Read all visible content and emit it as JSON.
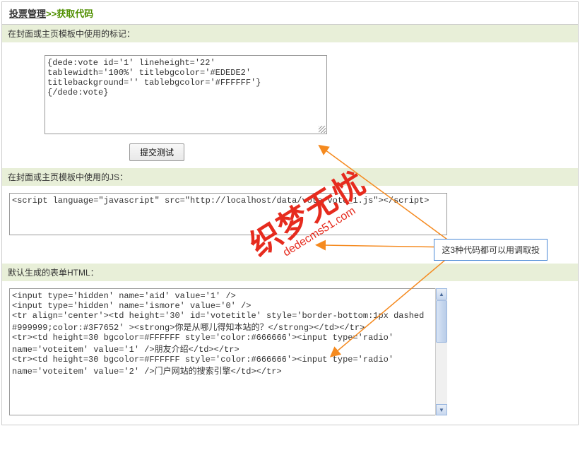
{
  "breadcrumb": {
    "vote_mgmt": "投票管理",
    "sep": ">>",
    "current": "获取代码"
  },
  "sections": {
    "tag": {
      "title": "在封面或主页模板中使用的标记：",
      "content": "{dede:vote id='1' lineheight='22'\ntablewidth='100%' titlebgcolor='#EDEDE2'\ntitlebackground='' tablebgcolor='#FFFFFF'}\n{/dede:vote}"
    },
    "js": {
      "title": "在封面或主页模板中使用的JS：",
      "content": "<script language=\"javascript\" src=\"http://localhost/data/vote/vote_1.js\"></script>"
    },
    "html": {
      "title": "默认生成的表单HTML：",
      "content": "<input type='hidden' name='aid' value='1' />\n<input type='hidden' name='ismore' value='0' />\n<tr align='center'><td height='30' id='votetitle' style='border-bottom:1px dashed #999999;color:#3F7652' ><strong>你是从哪儿得知本站的？</strong></td></tr>\n<tr><td height=30 bgcolor=#FFFFFF style='color:#666666'><input type='radio' name='voteitem' value='1' />朋友介绍</td></tr>\n<tr><td height=30 bgcolor=#FFFFFF style='color:#666666'><input type='radio' name='voteitem' value='2' />门户网站的搜索引擎</td></tr>"
    }
  },
  "button": {
    "submit_test": "提交测试"
  },
  "annotation": {
    "text": "这3种代码都可以用调取投"
  },
  "watermark": {
    "cn": "织梦无忧",
    "en": "dedecms51.com"
  }
}
